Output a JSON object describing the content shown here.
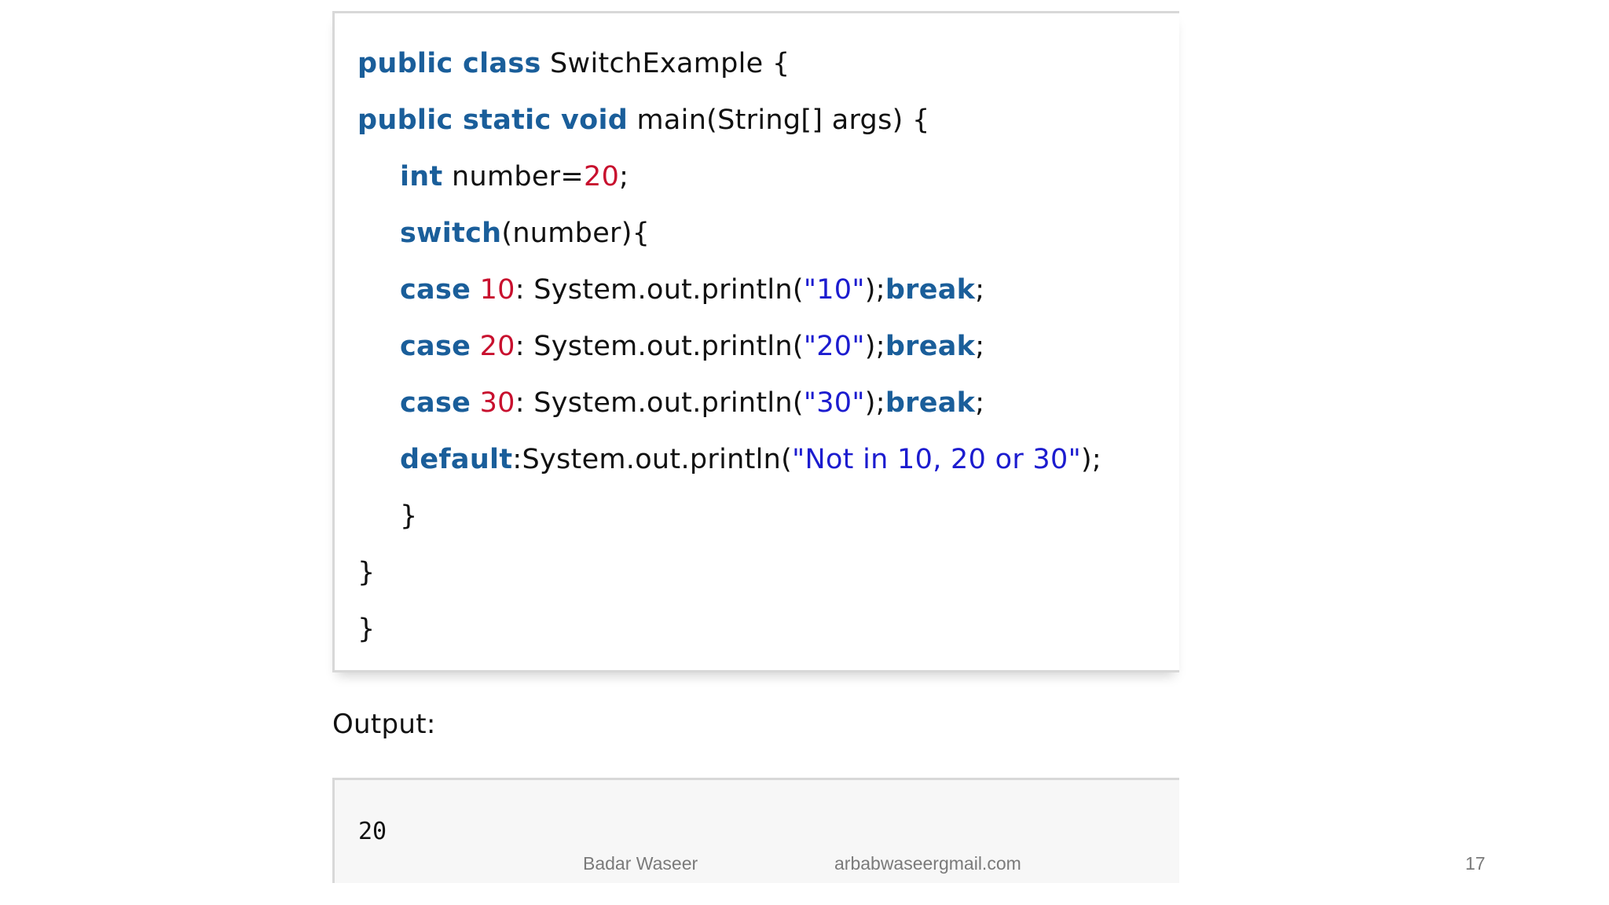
{
  "code": {
    "line1": {
      "kw": "public class",
      "rest": " SwitchExample {"
    },
    "line2": {
      "kw": "public static void",
      "rest": " main(String[] args) {"
    },
    "line3": {
      "kw": "int",
      "mid": " number=",
      "num": "20",
      "end": ";"
    },
    "line4": {
      "kw": "switch",
      "rest": "(number){"
    },
    "case10": {
      "kw": "case",
      "sp": " ",
      "num": "10",
      "mid": ": System.out.println(",
      "str": "\"10\"",
      "mid2": ");",
      "kw2": "break",
      "end": ";"
    },
    "case20": {
      "kw": "case",
      "sp": " ",
      "num": "20",
      "mid": ": System.out.println(",
      "str": "\"20\"",
      "mid2": ");",
      "kw2": "break",
      "end": ";"
    },
    "case30": {
      "kw": "case",
      "sp": " ",
      "num": "30",
      "mid": ": System.out.println(",
      "str": "\"30\"",
      "mid2": ");",
      "kw2": "break",
      "end": ";"
    },
    "default": {
      "kw": "default",
      "mid": ":System.out.println(",
      "str": "\"Not in 10, 20 or 30\"",
      "end": ");"
    },
    "close_switch": "}",
    "close_main": "}",
    "close_class": "}"
  },
  "output": {
    "label": "Output:",
    "value": "20"
  },
  "footer": {
    "author": "Badar Waseer",
    "email": "arbabwaseergmail.com",
    "page_number": "17"
  },
  "colors": {
    "keyword": "#1a5e9a",
    "number": "#c8102e",
    "string": "#1c1ccf"
  }
}
